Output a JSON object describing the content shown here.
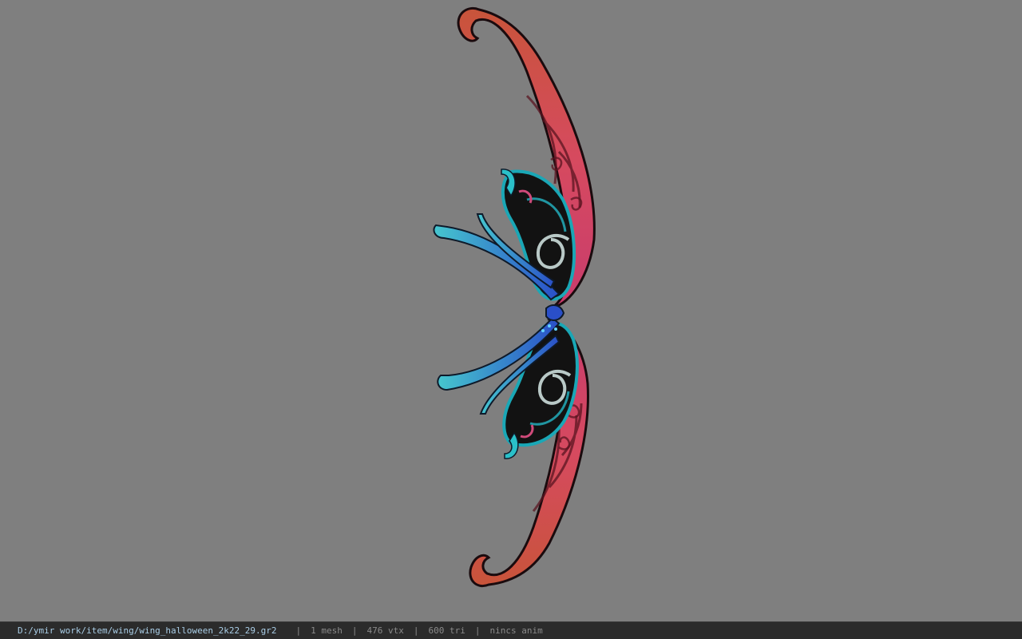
{
  "status": {
    "file_path": "D:/ymir work/item/wing/wing_halloween_2k22_29.gr2",
    "mesh": "1 mesh",
    "vertices": "476 vtx",
    "triangles": "600 tri",
    "animation": "nincs anim",
    "separator": "|"
  },
  "viewport": {
    "background_color": "#7f7f7f",
    "model": "wing-model"
  }
}
